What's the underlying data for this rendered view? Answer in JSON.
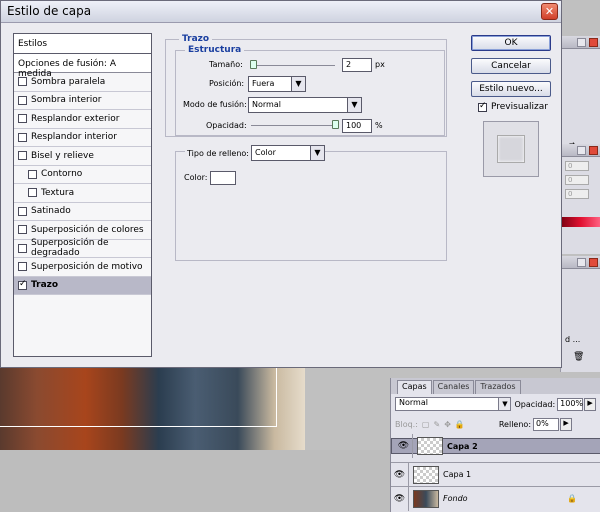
{
  "dialog": {
    "title": "Estilo de capa",
    "close_label": "✕"
  },
  "styles_list": {
    "header": "Estilos",
    "blend_options": "Opciones de fusión: A medida",
    "items": [
      {
        "label": "Sombra paralela",
        "checked": false,
        "indent": false,
        "active": false
      },
      {
        "label": "Sombra interior",
        "checked": false,
        "indent": false,
        "active": false
      },
      {
        "label": "Resplandor exterior",
        "checked": false,
        "indent": false,
        "active": false
      },
      {
        "label": "Resplandor interior",
        "checked": false,
        "indent": false,
        "active": false
      },
      {
        "label": "Bisel y relieve",
        "checked": false,
        "indent": false,
        "active": false
      },
      {
        "label": "Contorno",
        "checked": false,
        "indent": true,
        "active": false
      },
      {
        "label": "Textura",
        "checked": false,
        "indent": true,
        "active": false
      },
      {
        "label": "Satinado",
        "checked": false,
        "indent": false,
        "active": false
      },
      {
        "label": "Superposición de colores",
        "checked": false,
        "indent": false,
        "active": false
      },
      {
        "label": "Superposición de degradado",
        "checked": false,
        "indent": false,
        "active": false
      },
      {
        "label": "Superposición de motivo",
        "checked": false,
        "indent": false,
        "active": false
      },
      {
        "label": "Trazo",
        "checked": true,
        "indent": false,
        "active": true
      }
    ]
  },
  "stroke": {
    "section_title": "Trazo",
    "structure_title": "Estructura",
    "size_label": "Tamaño:",
    "size_value": "2",
    "size_unit": "px",
    "size_fraction": 0.02,
    "position_label": "Posición:",
    "position_value": "Fuera",
    "blend_label": "Modo de fusión:",
    "blend_value": "Normal",
    "opacity_label": "Opacidad:",
    "opacity_value": "100",
    "opacity_unit": "%",
    "opacity_fraction": 1.0,
    "fill_type_label": "Tipo de relleno:",
    "fill_type_value": "Color",
    "color_label": "Color:",
    "color_value": "#ffffff"
  },
  "buttons": {
    "ok": "OK",
    "cancel": "Cancelar",
    "new_style": "Estilo nuevo...",
    "preview": "Previsualizar",
    "preview_checked": true
  },
  "layers_panel": {
    "tabs": [
      "Capas",
      "Canales",
      "Trazados"
    ],
    "blend_mode": "Normal",
    "opacity_label": "Opacidad:",
    "opacity_value": "100%",
    "lock_label": "Bloq.:",
    "fill_label": "Relleno:",
    "fill_value": "0%",
    "layers": [
      {
        "name": "Capa 2",
        "selected": true
      },
      {
        "name": "Capa 1",
        "selected": false
      },
      {
        "name": "Fondo",
        "selected": false
      }
    ]
  },
  "side_panel": {
    "values": [
      "0",
      "0",
      "0"
    ],
    "label": "d ..."
  }
}
